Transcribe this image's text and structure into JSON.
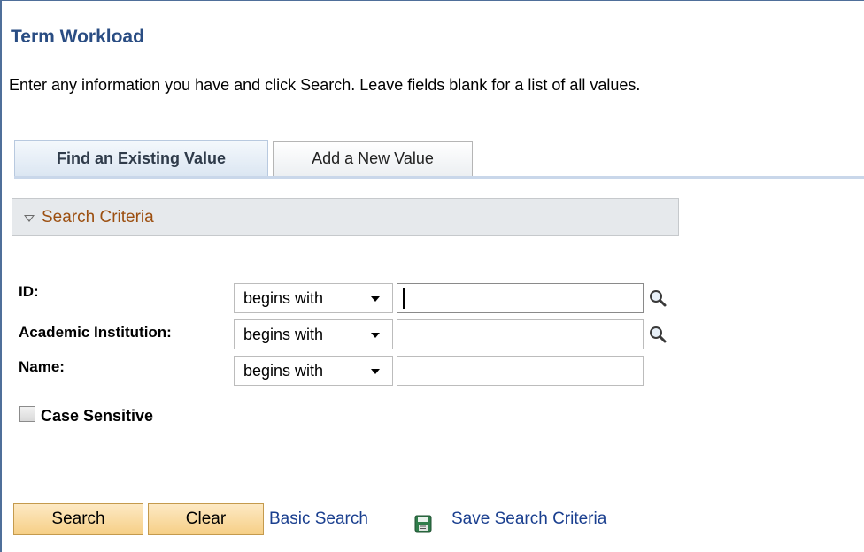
{
  "page": {
    "title": "Term Workload",
    "instructions": "Enter any information you have and click Search. Leave fields blank for a list of all values."
  },
  "tabs": {
    "find_existing": "Find an Existing Value",
    "add_new_accel": "A",
    "add_new_rest": "dd a New Value"
  },
  "section": {
    "title": "Search Criteria",
    "toggle_icon": "collapse-triangle-icon"
  },
  "fields": [
    {
      "label": "ID:",
      "operator": "begins with",
      "value": ""
    },
    {
      "label": "Academic Institution:",
      "operator": "begins with",
      "value": ""
    },
    {
      "label": "Name:",
      "operator": "begins with",
      "value": ""
    }
  ],
  "options": {
    "case_sensitive_label": "Case Sensitive",
    "case_sensitive_checked": false
  },
  "actions": {
    "search_label": "Search",
    "clear_label": "Clear",
    "basic_search_label": "Basic Search",
    "save_criteria_label": "Save Search Criteria"
  },
  "icons": {
    "lookup": "magnifying-glass-icon",
    "save": "floppy-disk-icon"
  },
  "colors": {
    "title": "#2a4d83",
    "section_title": "#9c4f10",
    "link": "#1a3f8f",
    "button_fill": "#f6cf86"
  }
}
